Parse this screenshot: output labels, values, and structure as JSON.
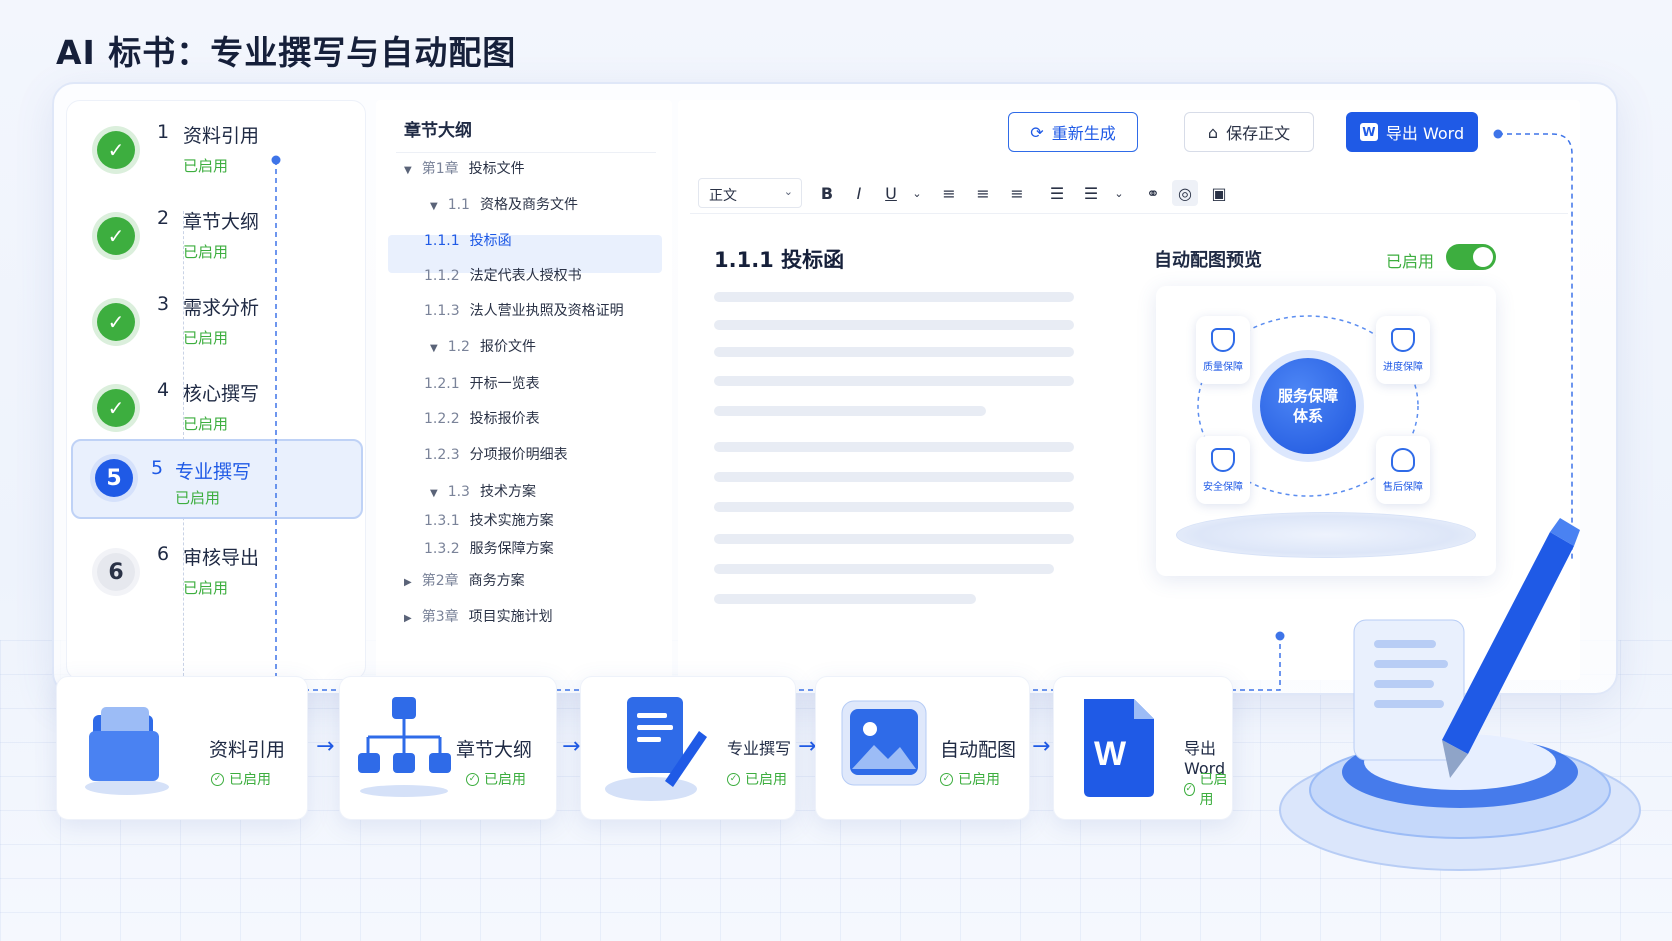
{
  "page_title": "AI 标书：专业撰写与自动配图",
  "stepper": {
    "steps": [
      {
        "num": "1",
        "label": "资料引用",
        "status": "已启用",
        "state": "done"
      },
      {
        "num": "2",
        "label": "章节大纲",
        "status": "已启用",
        "state": "done"
      },
      {
        "num": "3",
        "label": "需求分析",
        "status": "已启用",
        "state": "done"
      },
      {
        "num": "4",
        "label": "核心撰写",
        "status": "已启用",
        "state": "done"
      },
      {
        "num": "5",
        "label": "专业撰写",
        "status": "已启用",
        "state": "active"
      },
      {
        "num": "6",
        "label": "审核导出",
        "status": "已启用",
        "state": "pending"
      }
    ]
  },
  "outline": {
    "title": "章节大纲",
    "nodes": [
      {
        "code": "第1章",
        "text": "投标文件",
        "caret": "▼"
      },
      {
        "code": "1.1",
        "text": "资格及商务文件",
        "caret": "▼"
      },
      {
        "code": "1.1.1",
        "text": "投标函",
        "selected": true
      },
      {
        "code": "1.1.2",
        "text": "法定代表人授权书"
      },
      {
        "code": "1.1.3",
        "text": "法人营业执照及资格证明"
      },
      {
        "code": "1.2",
        "text": "报价文件",
        "caret": "▼"
      },
      {
        "code": "1.2.1",
        "text": "开标一览表"
      },
      {
        "code": "1.2.2",
        "text": "投标报价表"
      },
      {
        "code": "1.2.3",
        "text": "分项报价明细表"
      },
      {
        "code": "1.3",
        "text": "技术方案",
        "caret": "▼"
      },
      {
        "code": "1.3.1",
        "text": "技术实施方案"
      },
      {
        "code": "1.3.2",
        "text": "服务保障方案"
      },
      {
        "code": "第2章",
        "text": "商务方案",
        "caret": "▶"
      },
      {
        "code": "第3章",
        "text": "项目实施计划",
        "caret": "▶"
      }
    ]
  },
  "editor": {
    "buttons": {
      "regenerate": "重新生成",
      "save": "保存正文",
      "export": "导出 Word",
      "export_badge": "W"
    },
    "toolbar": {
      "style_select": "正文",
      "bold": "B",
      "italic": "I",
      "underline": "U"
    },
    "doc_heading": "1.1.1 投标函",
    "preview": {
      "label": "自动配图预览",
      "status": "已启用",
      "enabled": true,
      "center": [
        "服务保障",
        "体系"
      ],
      "satellites": [
        "质量保障",
        "进度保障",
        "安全保障",
        "售后保障"
      ]
    }
  },
  "workflow": [
    {
      "title": "资料引用",
      "status": "已启用"
    },
    {
      "title": "章节大纲",
      "status": "已启用"
    },
    {
      "title": "专业撰写",
      "status": "已启用"
    },
    {
      "title": "自动配图",
      "status": "已启用"
    },
    {
      "title": "导出Word",
      "status": "已启用"
    }
  ],
  "colors": {
    "primary": "#1f5ae6",
    "success": "#3dae3f",
    "text": "#1f2a44"
  }
}
